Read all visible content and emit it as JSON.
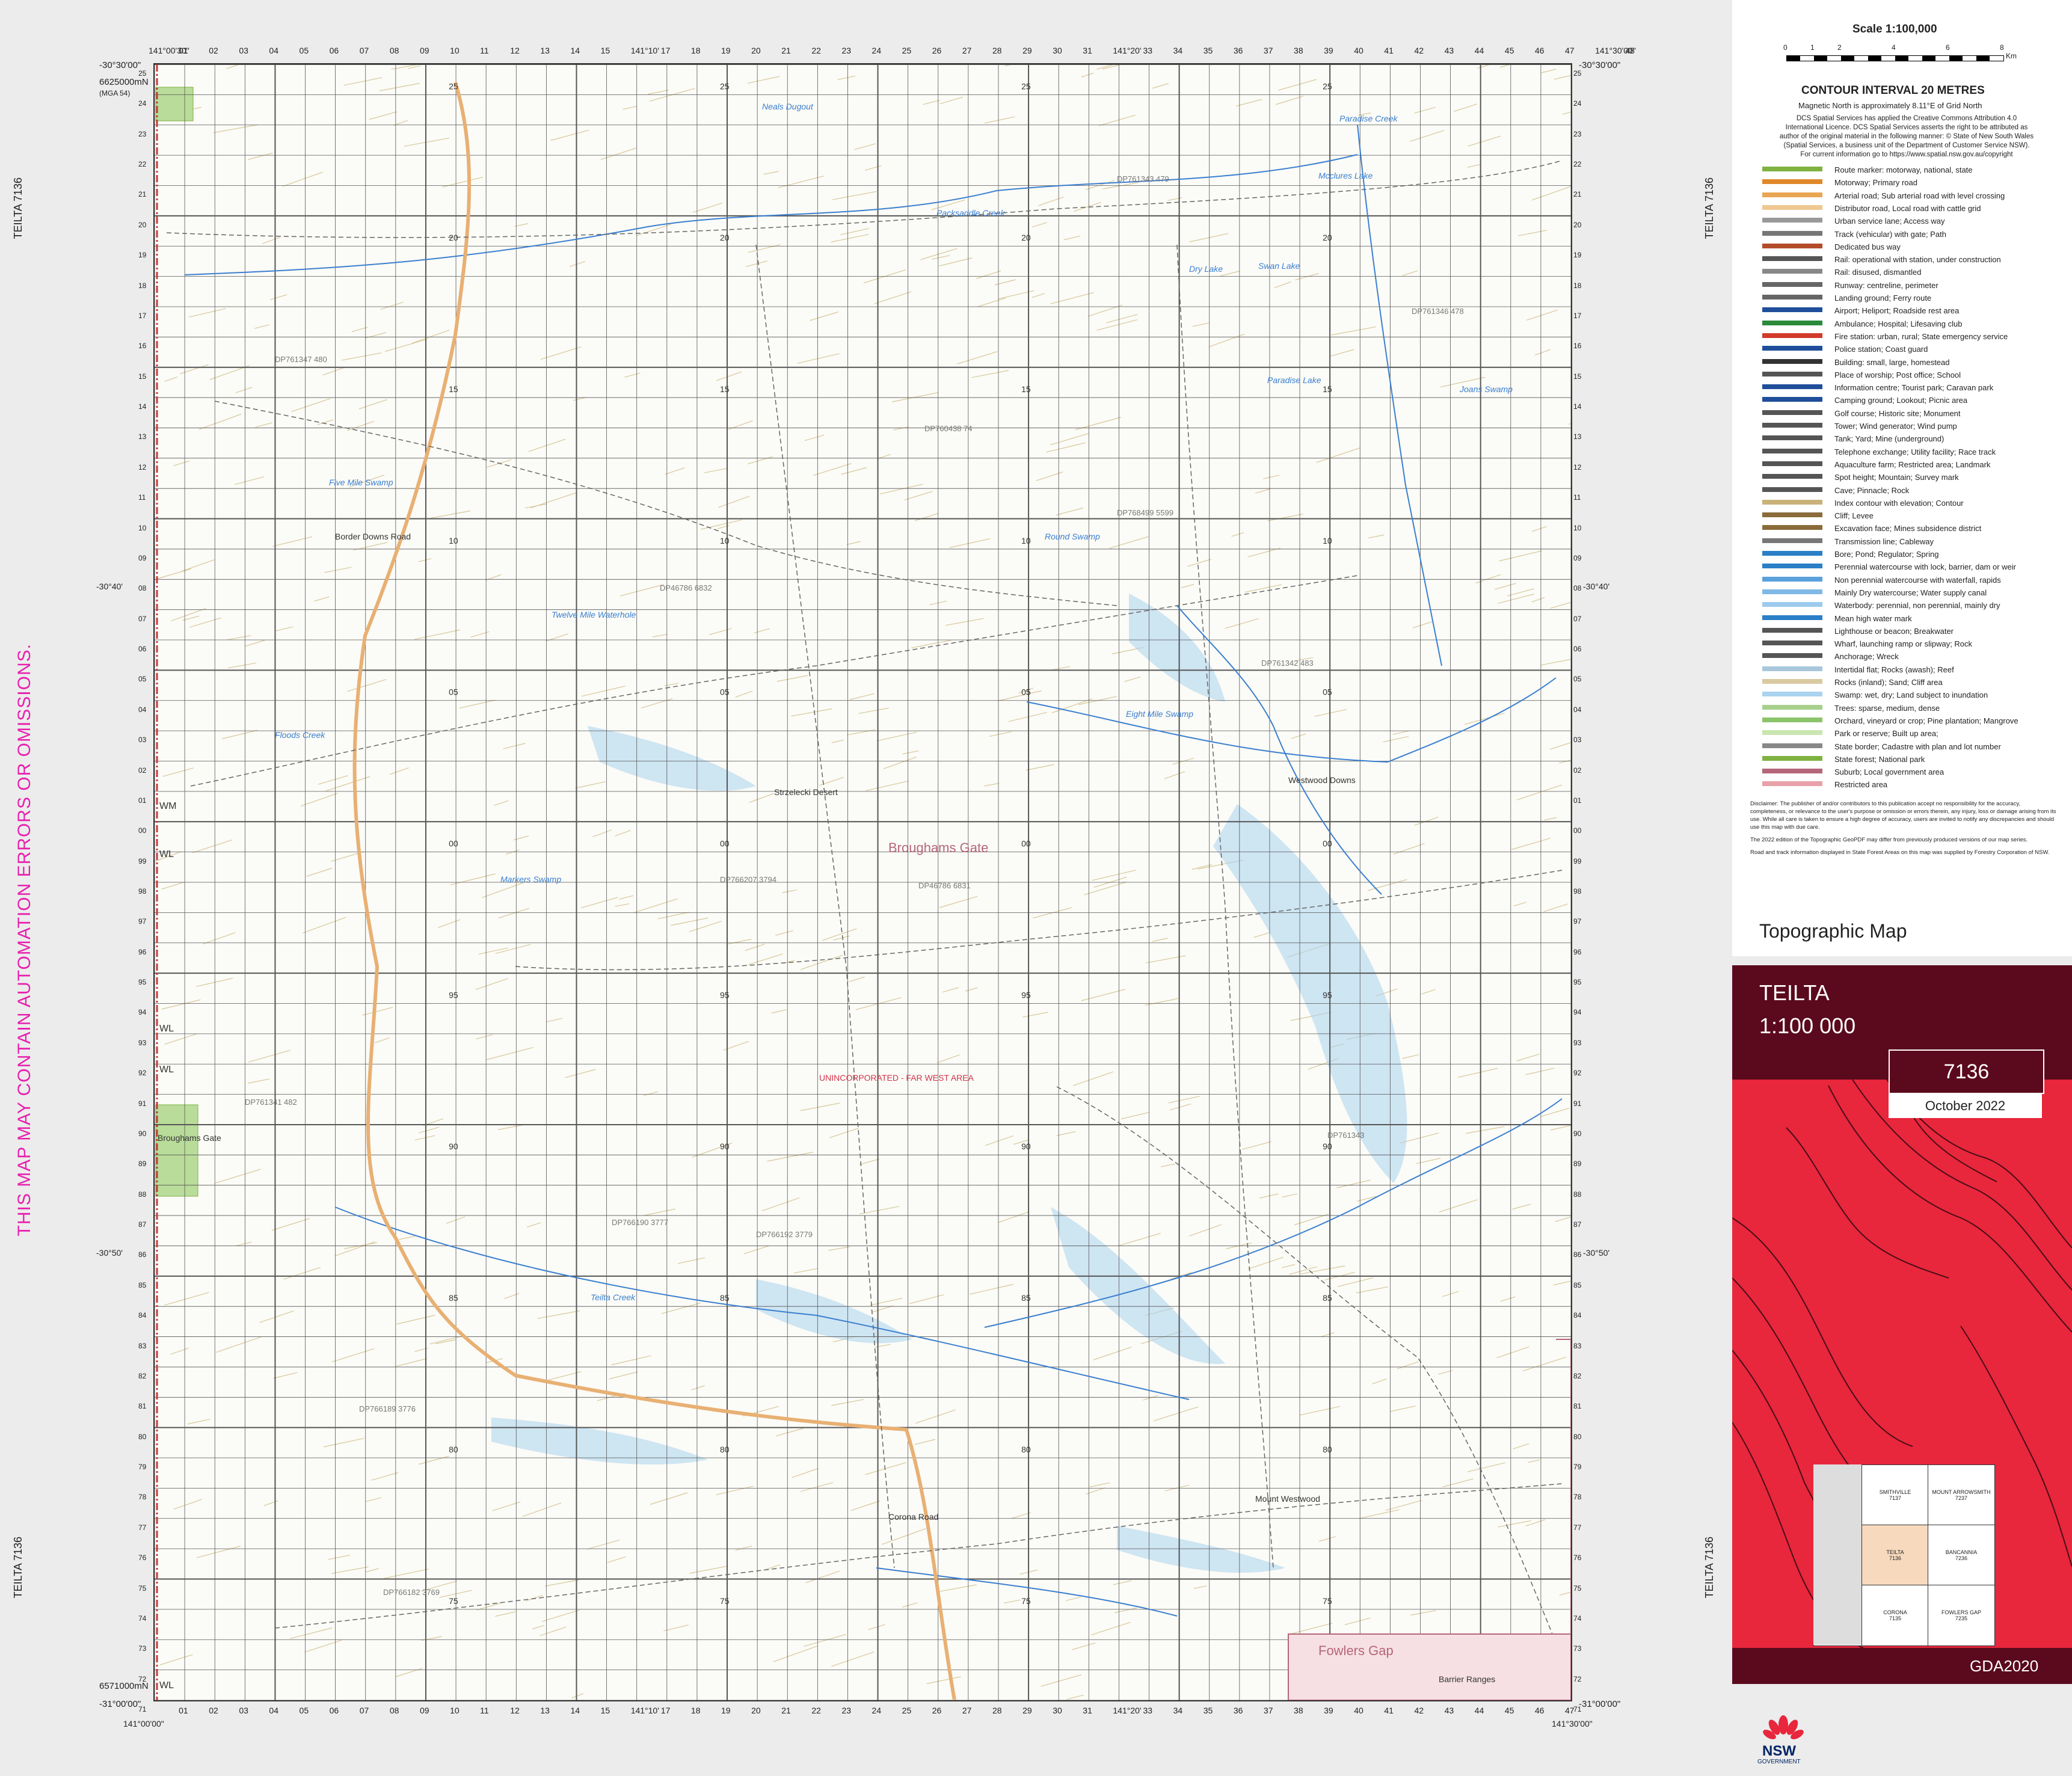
{
  "sheet_id_side": "TEILTA 7136",
  "disclaimer": "THIS MAP MAY CONTAIN AUTOMATION ERRORS OR OMISSIONS.",
  "top_ticks": [
    "141°00'30\"",
    "01",
    "02",
    "03",
    "04",
    "05",
    "06",
    "07",
    "08",
    "09",
    "10",
    "11",
    "12",
    "13",
    "14",
    "15",
    "141°10'",
    "17",
    "18",
    "19",
    "20",
    "21",
    "22",
    "23",
    "24",
    "25",
    "26",
    "27",
    "28",
    "29",
    "30",
    "31",
    "141°20'",
    "33",
    "34",
    "35",
    "36",
    "37",
    "38",
    "39",
    "40",
    "41",
    "42",
    "43",
    "44",
    "45",
    "46",
    "47",
    "141°30'00\"",
    "48"
  ],
  "bottom_ticks": [
    "01",
    "02",
    "03",
    "04",
    "05",
    "06",
    "07",
    "08",
    "09",
    "10",
    "11",
    "12",
    "13",
    "14",
    "15",
    "141°10'",
    "17",
    "18",
    "19",
    "20",
    "21",
    "22",
    "23",
    "24",
    "25",
    "26",
    "27",
    "28",
    "29",
    "30",
    "31",
    "141°20'",
    "33",
    "34",
    "35",
    "36",
    "37",
    "38",
    "39",
    "40",
    "41",
    "42",
    "43",
    "44",
    "45",
    "46",
    "47"
  ],
  "bottom_start": "141°00'00\"",
  "bottom_end": "141°30'00\"",
  "corner_labels": {
    "top_left_lat": "-30°30'00\"",
    "top_left_north": "6625000mN",
    "top_left_mga": "(MGA 54)",
    "top_right_lat": "-30°30'00\"",
    "bottom_left_lat": "-31°00'00\"",
    "bottom_left_north": "6571000mN",
    "bottom_right_lat": "-31°00'00\""
  },
  "side_ticks": [
    "25",
    "24",
    "23",
    "22",
    "21",
    "20",
    "19",
    "18",
    "17",
    "16",
    "15",
    "14",
    "13",
    "12",
    "11",
    "10",
    "09",
    "08",
    "07",
    "06",
    "05",
    "04",
    "03",
    "02",
    "01",
    "00",
    "99",
    "98",
    "97",
    "96",
    "95",
    "94",
    "93",
    "92",
    "91",
    "90",
    "89",
    "88",
    "87",
    "86",
    "85",
    "84",
    "83",
    "82",
    "81",
    "80",
    "79",
    "78",
    "77",
    "76",
    "75",
    "74",
    "73",
    "72",
    "71"
  ],
  "lat_marks": [
    "-30°40'",
    "-30°50'"
  ],
  "zone_marks": [
    "WM",
    "WL",
    "WL",
    "WL",
    "WL"
  ],
  "grid_labels": [
    "25",
    "20",
    "15",
    "10",
    "05",
    "00",
    "95",
    "90",
    "85",
    "80",
    "75"
  ],
  "place_labels": [
    {
      "name": "Neals Dugout",
      "kind": "water"
    },
    {
      "name": "Paradise Creek",
      "kind": "water"
    },
    {
      "name": "Mcclures Lake",
      "kind": "water"
    },
    {
      "name": "Packsaddle Creek",
      "kind": "water"
    },
    {
      "name": "Dry Lake",
      "kind": "water"
    },
    {
      "name": "Swan Lake",
      "kind": "water"
    },
    {
      "name": "Paradise Lake",
      "kind": "water"
    },
    {
      "name": "Joans Swamp",
      "kind": "water"
    },
    {
      "name": "Five Mile Swamp",
      "kind": "water"
    },
    {
      "name": "Round Swamp",
      "kind": "water"
    },
    {
      "name": "Twelve Mile Waterhole",
      "kind": "water"
    },
    {
      "name": "Eight Mile Swamp",
      "kind": "water"
    },
    {
      "name": "Floods Creek",
      "kind": "water"
    },
    {
      "name": "Markers Swamp",
      "kind": "water"
    },
    {
      "name": "Teilta Creek",
      "kind": "water"
    },
    {
      "name": "Strzelecki Desert",
      "kind": "feature"
    },
    {
      "name": "Broughams Gate",
      "kind": "locality"
    },
    {
      "name": "UNINCORPORATED - FAR WEST AREA",
      "kind": "admin"
    },
    {
      "name": "Border Downs Road",
      "kind": "road"
    },
    {
      "name": "Corona Road",
      "kind": "road"
    },
    {
      "name": "Westwood Downs",
      "kind": "homestead"
    },
    {
      "name": "Mount Westwood",
      "kind": "homestead"
    },
    {
      "name": "Fowlers Gap",
      "kind": "locality"
    },
    {
      "name": "Barrier Ranges",
      "kind": "feature"
    },
    {
      "name": "Broughams Gate",
      "kind": "park"
    }
  ],
  "parcel_labels": [
    "DP761343 479",
    "DP761346 478",
    "DP761347 480",
    "DP760438 74",
    "DP768499 5599",
    "DP46786 6832",
    "DP761342 483",
    "DP766207 3794",
    "DP46786 6831",
    "DP761341 482",
    "DP766190 3777",
    "DP766192 3779",
    "DP761343",
    "DP766189 3776",
    "DP766182 3769"
  ],
  "legend": {
    "scale_title": "Scale 1:100,000",
    "scale_ticks": [
      "0",
      "1",
      "2",
      "4",
      "6",
      "8"
    ],
    "scale_unit": "Km",
    "contour": "CONTOUR INTERVAL 20 METRES",
    "magnetic": "Magnetic North is approximately 8.11°E of Grid North",
    "copyright": [
      "DCS Spatial Services has applied the Creative Commons Attribution 4.0",
      "International Licence. DCS Spatial Services asserts the right to be attributed as",
      "author of the original material in the following manner: © State of New South Wales",
      "(Spatial Services, a business unit of the Department of Customer Service NSW).",
      "For current information go to https://www.spatial.nsw.gov.au/copyright"
    ],
    "items": [
      {
        "label": "Route marker: motorway, national, state",
        "color": "#7fb241"
      },
      {
        "label": "Motorway; Primary road",
        "color": "#e0892a"
      },
      {
        "label": "Arterial road; Sub arterial road with level crossing",
        "color": "#e8a653"
      },
      {
        "label": "Distributor road, Local road with cattle grid",
        "color": "#efc891"
      },
      {
        "label": "Urban service lane; Access way",
        "color": "#999999"
      },
      {
        "label": "Track (vehicular) with gate; Path",
        "color": "#777777"
      },
      {
        "label": "Dedicated bus way",
        "color": "#b44b2a"
      },
      {
        "label": "Rail: operational with station, under construction",
        "color": "#555555"
      },
      {
        "label": "Rail: disused, dismantled",
        "color": "#888888"
      },
      {
        "label": "Runway: centreline, perimeter",
        "color": "#666666"
      },
      {
        "label": "Landing ground; Ferry route",
        "color": "#666666"
      },
      {
        "label": "Airport; Heliport; Roadside rest area",
        "color": "#1f4e9b"
      },
      {
        "label": "Ambulance; Hospital; Lifesaving club",
        "color": "#2a8a3a"
      },
      {
        "label": "Fire station: urban, rural; State emergency service",
        "color": "#d23a2a"
      },
      {
        "label": "Police station; Coast guard",
        "color": "#1f4e9b"
      },
      {
        "label": "Building: small, large, homestead",
        "color": "#333333"
      },
      {
        "label": "Place of worship; Post office; School",
        "color": "#555555"
      },
      {
        "label": "Information centre; Tourist park; Caravan park",
        "color": "#1f4e9b"
      },
      {
        "label": "Camping ground; Lookout; Picnic area",
        "color": "#1f4e9b"
      },
      {
        "label": "Golf course; Historic site; Monument",
        "color": "#555555"
      },
      {
        "label": "Tower; Wind generator; Wind pump",
        "color": "#555555"
      },
      {
        "label": "Tank; Yard; Mine (underground)",
        "color": "#555555"
      },
      {
        "label": "Telephone exchange; Utility facility; Race track",
        "color": "#555555"
      },
      {
        "label": "Aquaculture farm; Restricted area; Landmark",
        "color": "#555555"
      },
      {
        "label": "Spot height; Mountain; Survey mark",
        "color": "#555555"
      },
      {
        "label": "Cave; Pinnacle; Rock",
        "color": "#555555"
      },
      {
        "label": "Index contour with elevation; Contour",
        "color": "#c9b27a"
      },
      {
        "label": "Cliff; Levee",
        "color": "#8a6b3a"
      },
      {
        "label": "Excavation face; Mines subsidence district",
        "color": "#8a6b3a"
      },
      {
        "label": "Transmission line; Cableway",
        "color": "#777777"
      },
      {
        "label": "Bore; Pond; Regulator; Spring",
        "color": "#2a7fc8"
      },
      {
        "label": "Perennial watercourse with lock, barrier, dam or weir",
        "color": "#2a7fc8"
      },
      {
        "label": "Non perennial watercourse with waterfall, rapids",
        "color": "#5aa0dc"
      },
      {
        "label": "Mainly Dry watercourse; Water supply canal",
        "color": "#7fb8e6"
      },
      {
        "label": "Waterbody: perennial, non perennial, mainly dry",
        "color": "#9ccbee"
      },
      {
        "label": "Mean high water mark",
        "color": "#2a7fc8"
      },
      {
        "label": "Lighthouse or beacon; Breakwater",
        "color": "#555555"
      },
      {
        "label": "Wharf, launching ramp or slipway; Rock",
        "color": "#555555"
      },
      {
        "label": "Anchorage; Wreck",
        "color": "#555555"
      },
      {
        "label": "Intertidal flat; Rocks (awash); Reef",
        "color": "#a9c7dc"
      },
      {
        "label": "Rocks (inland); Sand; Cliff area",
        "color": "#d9caa0"
      },
      {
        "label": "Swamp: wet, dry; Land subject to inundation",
        "color": "#a9d3ee"
      },
      {
        "label": "Trees: sparse, medium, dense",
        "color": "#a7d08c"
      },
      {
        "label": "Orchard, vineyard or crop; Pine plantation; Mangrove",
        "color": "#8cc46c"
      },
      {
        "label": "Park or reserve; Built up area;",
        "color": "#c9e6b0"
      },
      {
        "label": "State border; Cadastre with plan and lot number",
        "color": "#888888"
      },
      {
        "label": "State forest; National park",
        "color": "#7fb241"
      },
      {
        "label": "Suburb; Local government area",
        "color": "#b5667a"
      },
      {
        "label": "Restricted area",
        "color": "#e9a0a8"
      }
    ],
    "notes": [
      "Disclaimer: The publisher of and/or contributors to this publication accept no responsibility for the accuracy, completeness, or relevance to the user's purpose or omission or errors therein, any injury, loss or damage arising from its use. While all care is taken to ensure a high degree of accuracy, users are invited to notify any discrepancies and should use this map with due care.",
      "The 2022 edition of the Topographic GeoPDF may differ from previously produced versions of our map series.",
      "Road and track information displayed in State Forest Areas on this map was supplied by Forestry Corporation of NSW."
    ]
  },
  "cover": {
    "series": "Topographic Map",
    "name": "TEILTA",
    "scale": "1:100 000",
    "number": "7136",
    "date": "October 2022",
    "datum": "GDA2020",
    "adjoining": [
      {
        "name": "SMITHVILLE",
        "num": "7137",
        "pos": "top-center"
      },
      {
        "name": "MOUNT ARROWSMITH",
        "num": "7237",
        "pos": "top-right"
      },
      {
        "name": "TEILTA",
        "num": "7136",
        "pos": "center"
      },
      {
        "name": "BANCANNIA",
        "num": "7236",
        "pos": "mid-right"
      },
      {
        "name": "CORONA",
        "num": "7135",
        "pos": "bottom-center"
      },
      {
        "name": "FOWLERS GAP",
        "num": "7235",
        "pos": "bottom-right"
      }
    ],
    "logo_text": "NSW",
    "logo_sub": "GOVERNMENT"
  },
  "colors": {
    "water": "#3a7fd0",
    "swamp": "#a9d3ee",
    "road": "#e8b073",
    "contour": "#d7c89a",
    "park": "#b9dc9a",
    "admin": "#d2334a",
    "cover_red": "#e8263c",
    "cover_dark": "#5a0a1c"
  }
}
